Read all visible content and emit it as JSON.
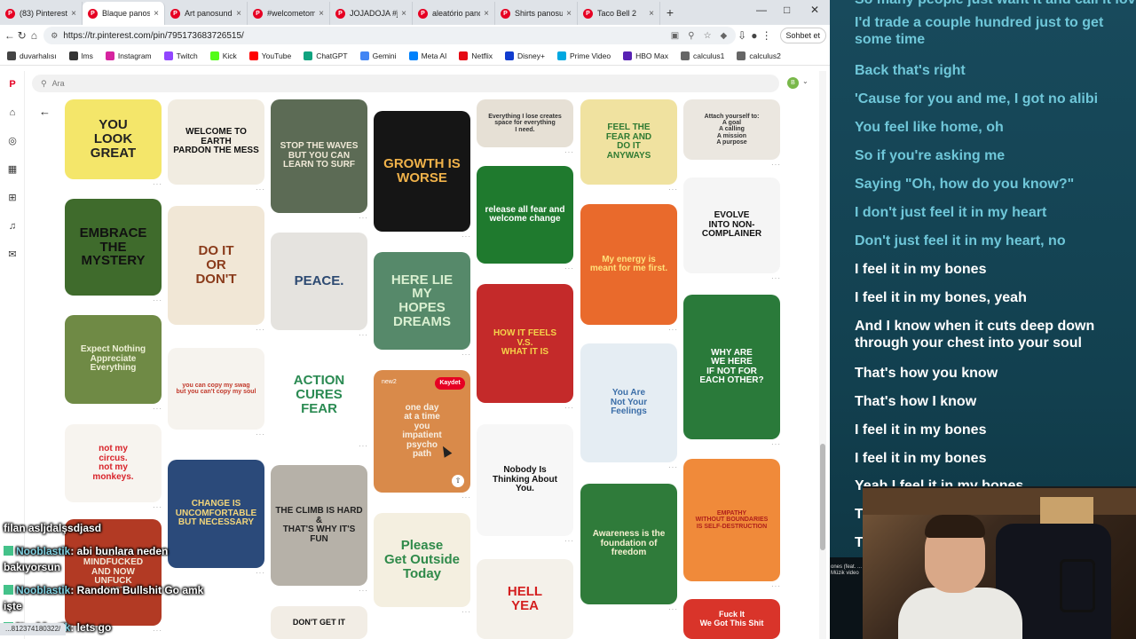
{
  "tabs": [
    {
      "label": "(83) Pinterest",
      "active": false
    },
    {
      "label": "Blaque panosundaki",
      "active": true
    },
    {
      "label": "Art panosundaki",
      "active": false
    },
    {
      "label": "#welcometomi",
      "active": false
    },
    {
      "label": "JOJADOJA #joja",
      "active": false
    },
    {
      "label": "aleatório panos",
      "active": false
    },
    {
      "label": "Shirts panosundaki",
      "active": false
    },
    {
      "label": "Taco Bell 2",
      "active": false
    }
  ],
  "address": {
    "url": "https://tr.pinterest.com/pin/795173683726515/",
    "chat_button": "Sohbet et"
  },
  "bookmarks": [
    {
      "label": "duvarhalısı",
      "color": "#444"
    },
    {
      "label": "lms",
      "color": "#333"
    },
    {
      "label": "Instagram",
      "color": "#d6249f"
    },
    {
      "label": "Twitch",
      "color": "#9146ff"
    },
    {
      "label": "Kick",
      "color": "#53fc18"
    },
    {
      "label": "YouTube",
      "color": "#ff0000"
    },
    {
      "label": "ChatGPT",
      "color": "#10a37f"
    },
    {
      "label": "Gemini",
      "color": "#4285f4"
    },
    {
      "label": "Meta AI",
      "color": "#0081fb"
    },
    {
      "label": "Netflix",
      "color": "#e50914"
    },
    {
      "label": "Disney+",
      "color": "#113ccf"
    },
    {
      "label": "Prime Video",
      "color": "#00a8e1"
    },
    {
      "label": "HBO Max",
      "color": "#5822b4"
    },
    {
      "label": "calculus1",
      "color": "#666"
    },
    {
      "label": "calculus2",
      "color": "#666"
    }
  ],
  "search": {
    "placeholder": "Ara",
    "avatar_letter": "B"
  },
  "pins": [
    {
      "lines": [
        "YOU",
        "LOOK",
        "GREAT"
      ],
      "bg": "#f4e66a",
      "fg": "#222"
    },
    {
      "lines": [
        "WELCOME TO",
        "EARTH",
        "PARDON THE MESS"
      ],
      "bg": "#f1ece1",
      "fg": "#111"
    },
    {
      "lines": [
        "STOP THE WAVES",
        "BUT YOU CAN",
        "LEARN TO SURF"
      ],
      "bg": "#5c6b55",
      "fg": "#f1ead8"
    },
    {
      "lines": [
        "GROWTH IS",
        "WORSE"
      ],
      "bg": "#151515",
      "fg": "#f0b24a"
    },
    {
      "lines": [
        "Everything I lose creates",
        "space for everything",
        "I need."
      ],
      "bg": "#e6e0d5",
      "fg": "#333"
    },
    {
      "lines": [
        "FEEL THE",
        "FEAR AND",
        "DO IT",
        "ANYWAYS"
      ],
      "bg": "#f0e2a0",
      "fg": "#2f7a32"
    },
    {
      "lines": [
        "Attach yourself to:",
        "A goal",
        "A calling",
        "A mission",
        "A purpose"
      ],
      "bg": "#ebe7e0",
      "fg": "#333"
    },
    {
      "lines": [
        "EMBRACE",
        "THE",
        "MYSTERY"
      ],
      "bg": "#3f6b2c",
      "fg": "#111"
    },
    {
      "lines": [
        "DO IT",
        "OR",
        "DON'T"
      ],
      "bg": "#f1e7d6",
      "fg": "#8a3b1b"
    },
    {
      "lines": [
        "PEACE."
      ],
      "bg": "#e5e3df",
      "fg": "#2d4a72"
    },
    {
      "lines": [
        "release all fear and welcome change"
      ],
      "bg": "#1f7a2e",
      "fg": "#ffffff"
    },
    {
      "lines": [
        "My energy is",
        "meant for me first."
      ],
      "bg": "#e96a2c",
      "fg": "#ffe07a"
    },
    {
      "lines": [
        "EVOLVE",
        "INTO NON-COMPLAINER"
      ],
      "bg": "#f5f5f5",
      "fg": "#111"
    },
    {
      "lines": [
        "HERE LIE",
        "MY",
        "HOPES",
        "DREAMS"
      ],
      "bg": "#56896a",
      "fg": "#d9efd0"
    },
    {
      "lines": [
        "Expect Nothing",
        "Appreciate Everything"
      ],
      "bg": "#6f8a45",
      "fg": "#eef0d6"
    },
    {
      "lines": [
        "you can copy my swag",
        "but you can't copy my soul"
      ],
      "bg": "#f6f3ee",
      "fg": "#c23a2c"
    },
    {
      "lines": [
        "ACTION",
        "CURES",
        "FEAR"
      ],
      "bg": "#ffffff",
      "fg": "#2a8a52"
    },
    {
      "lines": [
        "HOW IT FEELS",
        "V.S.",
        "WHAT IT IS"
      ],
      "bg": "#c42a2a",
      "fg": "#f5d34a"
    },
    {
      "lines": [
        "WHY ARE",
        "WE HERE",
        "IF NOT FOR",
        "EACH OTHER?"
      ],
      "bg": "#2a7a3a",
      "fg": "#ffffff"
    },
    {
      "lines": [
        "one day",
        "at a time",
        "you",
        "impatient",
        "psycho",
        "path"
      ],
      "bg": "#d98a4a",
      "fg": "#f7efe3"
    },
    {
      "lines": [
        "You Are",
        "Not Your",
        "Feelings"
      ],
      "bg": "#e5edf3",
      "fg": "#3b6ea8"
    },
    {
      "lines": [
        "not my",
        "circus.",
        "not my",
        "monkeys."
      ],
      "bg": "#f7f4ef",
      "fg": "#d8232a"
    },
    {
      "lines": [
        "CHANGE IS",
        "UNCOMFORTABLE",
        "BUT NECESSARY"
      ],
      "bg": "#2b4a7a",
      "fg": "#f2d57a"
    },
    {
      "lines": [
        "THE CLIMB IS HARD &",
        "THAT'S WHY IT'S FUN"
      ],
      "bg": "#b6b1a8",
      "fg": "#222"
    },
    {
      "lines": [
        "Nobody Is",
        "Thinking About",
        "You."
      ],
      "bg": "#f7f7f7",
      "fg": "#111"
    },
    {
      "lines": [
        "Awareness is the foundation of freedom"
      ],
      "bg": "#2f7b3a",
      "fg": "#f5f0d0"
    },
    {
      "lines": [
        "EMPATHY",
        "WITHOUT BOUNDARIES",
        "IS SELF-DESTRUCTION"
      ],
      "bg": "#f08a3a",
      "fg": "#b0201b"
    },
    {
      "lines": [
        "Please",
        "Get Outside",
        "Today"
      ],
      "bg": "#f4efe0",
      "fg": "#2f8a4a"
    },
    {
      "lines": [
        "WE'VE",
        "MINDFUCKED",
        "AND NOW",
        "UNFUCK",
        "MUST"
      ],
      "bg": "#b23a24",
      "fg": "#f2e8d8"
    },
    {
      "lines": [
        "DON'T GET IT"
      ],
      "bg": "#f2ede5",
      "fg": "#111"
    },
    {
      "lines": [
        "HELL",
        "YEA"
      ],
      "bg": "#f4f1ea",
      "fg": "#d41f1f"
    },
    {
      "lines": [
        "Fuck It",
        "We Got This Shit"
      ],
      "bg": "#d9342a",
      "fg": "#ffffff"
    }
  ],
  "pin_overlay": {
    "save_label": "Kaydet",
    "board_tag": "new2"
  },
  "chat": [
    {
      "user": "",
      "text": "filan asljdalşsdjasd"
    },
    {
      "user": "Nooblastik",
      "text": ": abi bunlara neden"
    },
    {
      "user": "",
      "text": "bakıyorsun"
    },
    {
      "user": "Nooblastik",
      "text": ": Random Bullshit Go amk"
    },
    {
      "user": "",
      "text": "işte"
    },
    {
      "user": "Nooblastik",
      "text": ": lets go"
    }
  ],
  "status_url": "...812374180322/",
  "lyrics": [
    {
      "text": "So many people just want it and call it love",
      "active": false
    },
    {
      "text": "I'd trade a couple hundred just to get some time",
      "active": false
    },
    {
      "text": "Back that's right",
      "active": false
    },
    {
      "text": "'Cause for you and me, I got no alibi",
      "active": false
    },
    {
      "text": "You feel like home, oh",
      "active": false
    },
    {
      "text": "So if you're asking me",
      "active": false
    },
    {
      "text": "Saying \"Oh, how do you know?\"",
      "active": false
    },
    {
      "text": "I don't just feel it in my heart",
      "active": false
    },
    {
      "text": "Don't just feel it in my heart, no",
      "active": false
    },
    {
      "text": "I feel it in my bones",
      "active": true
    },
    {
      "text": "I feel it in my bones, yeah",
      "active": true
    },
    {
      "text": "And I know when it cuts deep down through your chest into your soul",
      "active": true
    },
    {
      "text": "That's how you know",
      "active": true
    },
    {
      "text": "That's how I know",
      "active": true
    },
    {
      "text": "I feel it in my bones",
      "active": true
    },
    {
      "text": "I feel it in my bones",
      "active": true
    },
    {
      "text": "Yeah I feel it in my bones",
      "active": true
    },
    {
      "text": "T",
      "active": true
    },
    {
      "text": "T",
      "active": true
    }
  ],
  "widget": {
    "label": "ones (feat. ... Müzik video"
  }
}
